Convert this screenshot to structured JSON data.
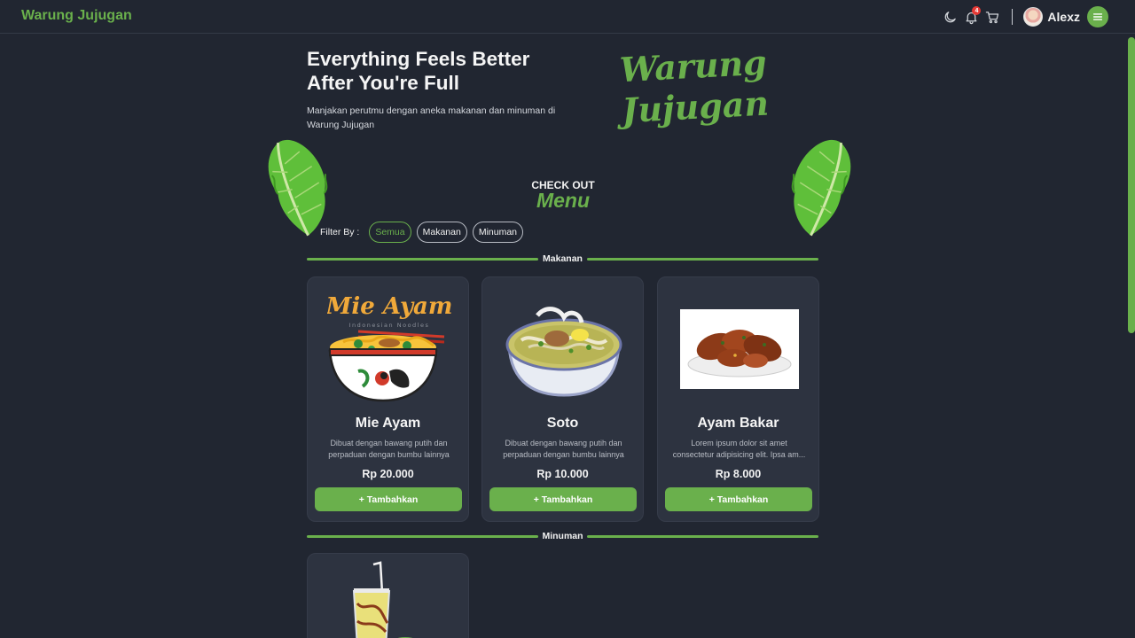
{
  "nav": {
    "brand": "Warung Jujugan",
    "notification_count": "4",
    "user_name": "Alexz",
    "accent_color": "#6ab04c"
  },
  "hero": {
    "title_line1": "Everything Feels Better",
    "title_line2": "After You're Full",
    "description": "Manjakan perutmu dengan aneka makanan dan minuman di Warung Jujugan",
    "logo_line1": "Warung",
    "logo_line2": "Jujugan"
  },
  "menu_section": {
    "checkout_label": "CHECK OUT",
    "menu_label": "Menu",
    "filter_label": "Filter By :",
    "filters": [
      "Semua",
      "Makanan",
      "Minuman"
    ],
    "active_filter": "Semua"
  },
  "categories": {
    "food_title": "Makanan",
    "drink_title": "Minuman"
  },
  "food_items": [
    {
      "name": "Mie Ayam",
      "logo_text": "Mie Ayam",
      "logo_subtext": "Indonesian Noodles",
      "description": "Dibuat dengan bawang putih dan perpaduan dengan bumbu lainnya",
      "price": "Rp 20.000",
      "button": "+ Tambahkan"
    },
    {
      "name": "Soto",
      "description": "Dibuat dengan bawang putih dan perpaduan dengan bumbu lainnya",
      "price": "Rp 10.000",
      "button": "+ Tambahkan"
    },
    {
      "name": "Ayam Bakar",
      "description": "Lorem ipsum dolor sit amet consectetur adipisicing elit. Ipsa am...",
      "price": "Rp 8.000",
      "button": "+ Tambahkan"
    }
  ],
  "icons": [
    "moon-icon",
    "bell-icon",
    "cart-icon",
    "hamburger-icon"
  ]
}
